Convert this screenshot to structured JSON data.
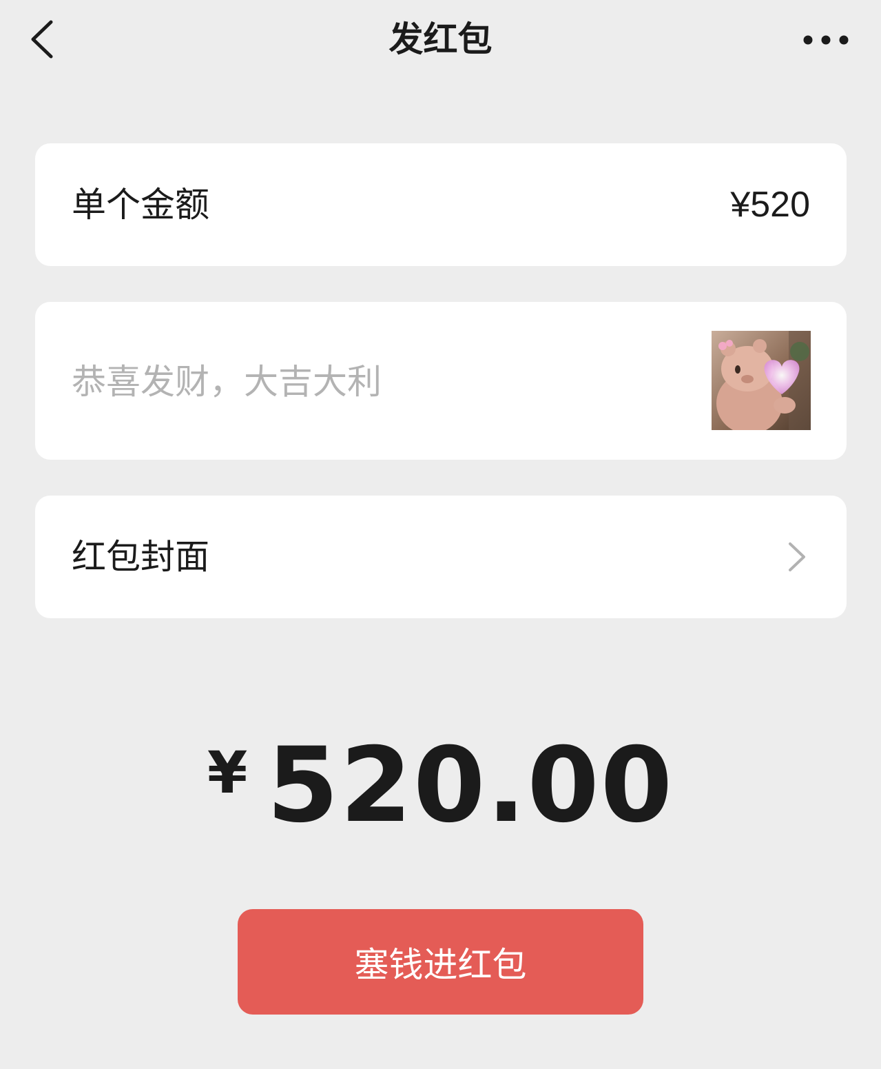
{
  "nav": {
    "title": "发红包",
    "back_icon": "chevron-left-icon",
    "more_icon": "more-dots-icon"
  },
  "amount_row": {
    "label": "单个金额",
    "value": "¥520"
  },
  "greeting": {
    "placeholder": "恭喜发财，大吉大利",
    "value": "",
    "sticker_icon": "bear-with-heart-sticker"
  },
  "cover_row": {
    "label": "红包封面",
    "icon": "chevron-right-icon"
  },
  "total": {
    "currency": "¥",
    "amount": "520.00"
  },
  "submit": {
    "label": "塞钱进红包"
  },
  "colors": {
    "background": "#ededed",
    "card": "#ffffff",
    "primary_button": "#e45c56",
    "text_primary": "#1b1b1b",
    "text_placeholder": "#b3b3b3",
    "chevron": "#b2b2b2"
  }
}
